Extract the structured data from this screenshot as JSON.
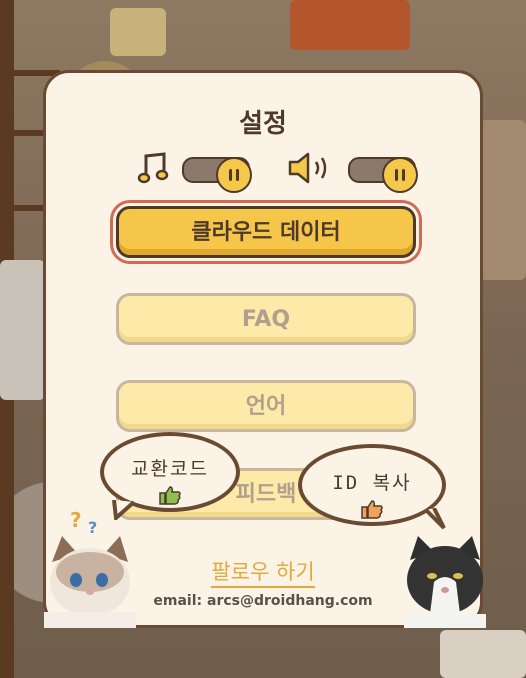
{
  "settings": {
    "title": "설정",
    "music_icon": "music-note-icon",
    "sound_icon": "speaker-icon",
    "music_level": 1.0,
    "sound_level": 1.0
  },
  "buttons": {
    "cloud_data": "클라우드 데이터",
    "faq": "FAQ",
    "language": "언어",
    "feedback": "피드백"
  },
  "bubbles": {
    "exchange_code": "교환코드",
    "copy_id": "ID 복사"
  },
  "footer": {
    "follow": "팔로우 하기",
    "email": "email: arcs@droidhang.com"
  },
  "colors": {
    "panel_bg": "#fbf4e6",
    "border": "#6b4a33",
    "primary_button": "#f5c64a",
    "soft_button": "#fde9a8",
    "follow_link": "#e3a93c",
    "thumb_green": "#8cc152",
    "thumb_orange": "#f0a35e"
  }
}
